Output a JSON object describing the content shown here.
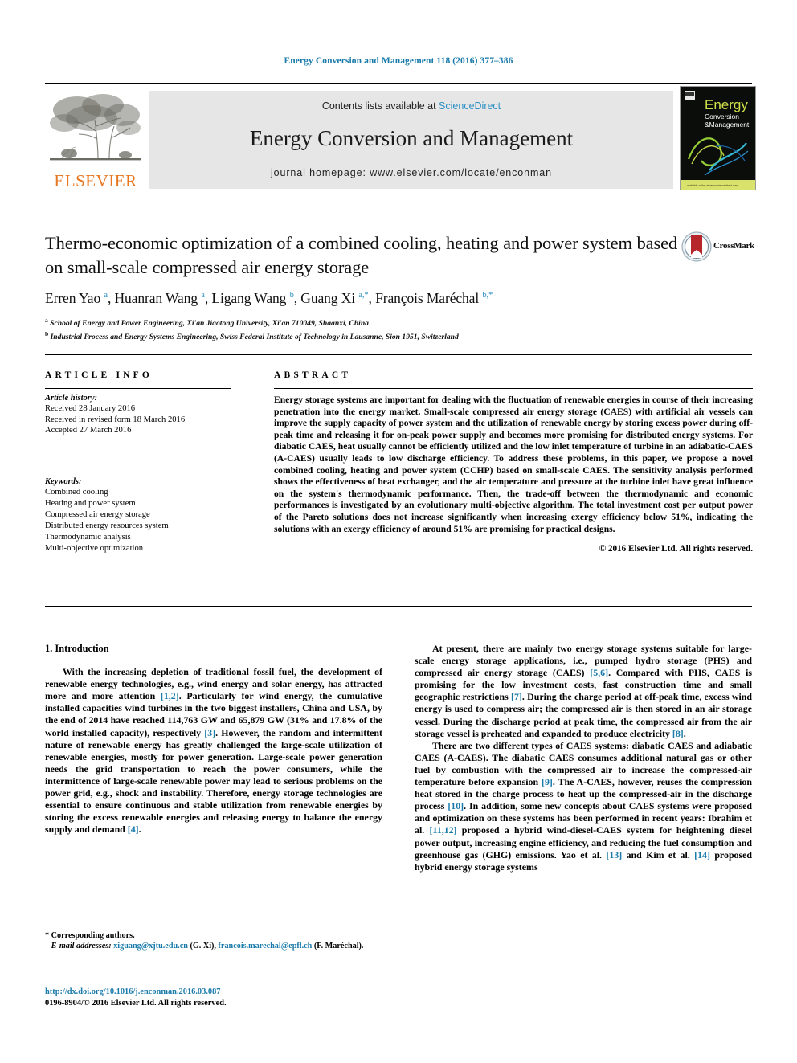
{
  "running_head": "Energy Conversion and Management 118 (2016) 377–386",
  "masthead": {
    "publisher_logo_word": "ELSEVIER",
    "contents_prefix": "Contents lists available at ",
    "contents_link": "ScienceDirect",
    "journal_title": "Energy Conversion and Management",
    "homepage": "journal homepage: www.elsevier.com/locate/enconman",
    "cover_title_main": "Energy",
    "cover_title_sub1": "Conversion",
    "cover_title_sub2": "Management"
  },
  "article": {
    "title": "Thermo-economic optimization of a combined cooling, heating and power system based on small-scale compressed air energy storage",
    "authors_html": "Erren Yao <sup>a</sup>, Huanran Wang <sup>a</sup>, Ligang Wang <sup>b</sup>, Guang Xi <sup>a,<span>*</span></sup>, François Maréchal <sup>b,<span>*</span></sup>",
    "affiliations": [
      "School of Energy and Power Engineering, Xi'an Jiaotong University, Xi'an 710049, Shaanxi, China",
      "Industrial Process and Energy Systems Engineering, Swiss Federal Institute of Technology in Lausanne, Sion 1951, Switzerland"
    ],
    "crossmark_label": "CrossMark"
  },
  "info": {
    "heading": "ARTICLE INFO",
    "history_label": "Article history:",
    "history": [
      "Received 28 January 2016",
      "Received in revised form 18 March 2016",
      "Accepted 27 March 2016"
    ],
    "keywords_label": "Keywords:",
    "keywords": [
      "Combined cooling",
      "Heating and power system",
      "Compressed air energy storage",
      "Distributed energy resources system",
      "Thermodynamic analysis",
      "Multi-objective optimization"
    ]
  },
  "abstract": {
    "heading": "ABSTRACT",
    "text": "Energy storage systems are important for dealing with the fluctuation of renewable energies in course of their increasing penetration into the energy market. Small-scale compressed air energy storage (CAES) with artificial air vessels can improve the supply capacity of power system and the utilization of renewable energy by storing excess power during off-peak time and releasing it for on-peak power supply and becomes more promising for distributed energy systems. For diabatic CAES, heat usually cannot be efficiently utilized and the low inlet temperature of turbine in an adiabatic-CAES (A-CAES) usually leads to low discharge efficiency. To address these problems, in this paper, we propose a novel combined cooling, heating and power system (CCHP) based on small-scale CAES. The sensitivity analysis performed shows the effectiveness of heat exchanger, and the air temperature and pressure at the turbine inlet have great influence on the system's thermodynamic performance. Then, the trade-off between the thermodynamic and economic performances is investigated by an evolutionary multi-objective algorithm. The total investment cost per output power of the Pareto solutions does not increase significantly when increasing exergy efficiency below 51%, indicating the solutions with an exergy efficiency of around 51% are promising for practical designs.",
    "copyright": "© 2016 Elsevier Ltd. All rights reserved."
  },
  "body": {
    "section_heading": "1. Introduction",
    "left_paragraphs": [
      "With the increasing depletion of traditional fossil fuel, the development of renewable energy technologies, e.g., wind energy and solar energy, has attracted more and more attention [1,2]. Particularly for wind energy, the cumulative installed capacities wind turbines in the two biggest installers, China and USA, by the end of 2014 have reached 114,763 GW and 65,879 GW (31% and 17.8% of the world installed capacity), respectively [3]. However, the random and intermittent nature of renewable energy has greatly challenged the large-scale utilization of renewable energies, mostly for power generation. Large-scale power generation needs the grid transportation to reach the power consumers, while the intermittence of large-scale renewable power may lead to serious problems on the power grid, e.g., shock and instability. Therefore, energy storage technologies are essential to ensure continuous and stable utilization from renewable energies by storing the excess renewable energies and releasing energy to balance the energy supply and demand [4]."
    ],
    "right_paragraphs": [
      "At present, there are mainly two energy storage systems suitable for large-scale energy storage applications, i.e., pumped hydro storage (PHS) and compressed air energy storage (CAES) [5,6]. Compared with PHS, CAES is promising for the low investment costs, fast construction time and small geographic restrictions [7]. During the charge period at off-peak time, excess wind energy is used to compress air; the compressed air is then stored in an air storage vessel. During the discharge period at peak time, the compressed air from the air storage vessel is preheated and expanded to produce electricity [8].",
      "There are two different types of CAES systems: diabatic CAES and adiabatic CAES (A-CAES). The diabatic CAES consumes additional natural gas or other fuel by combustion with the compressed air to increase the compressed-air temperature before expansion [9]. The A-CAES, however, reuses the compression heat stored in the charge process to heat up the compressed-air in the discharge process [10]. In addition, some new concepts about CAES systems were proposed and optimization on these systems has been performed in recent years: Ibrahim et al. [11,12] proposed a hybrid wind-diesel-CAES system for heightening diesel power output, increasing engine efficiency, and reducing the fuel consumption and greenhouse gas (GHG) emissions. Yao et al. [13] and Kim et al. [14] proposed hybrid energy storage systems"
    ]
  },
  "footnote": {
    "corresponding": "* Corresponding authors.",
    "email_label": "E-mail addresses:",
    "email1": "xiguang@xjtu.edu.cn",
    "email1_owner": "(G. Xi),",
    "email2": "francois.marechal@epfl.ch",
    "email2_owner": "(F. Maréchal)."
  },
  "imprint": {
    "doi": "http://dx.doi.org/10.1016/j.enconman.2016.03.087",
    "issn_line": "0196-8904/© 2016 Elsevier Ltd. All rights reserved."
  },
  "colors": {
    "link_blue": "#1a7bab",
    "sciencedirect_blue": "#2b8fc4",
    "elsevier_orange": "#e87722",
    "band_gray": "#e6e6e6"
  }
}
